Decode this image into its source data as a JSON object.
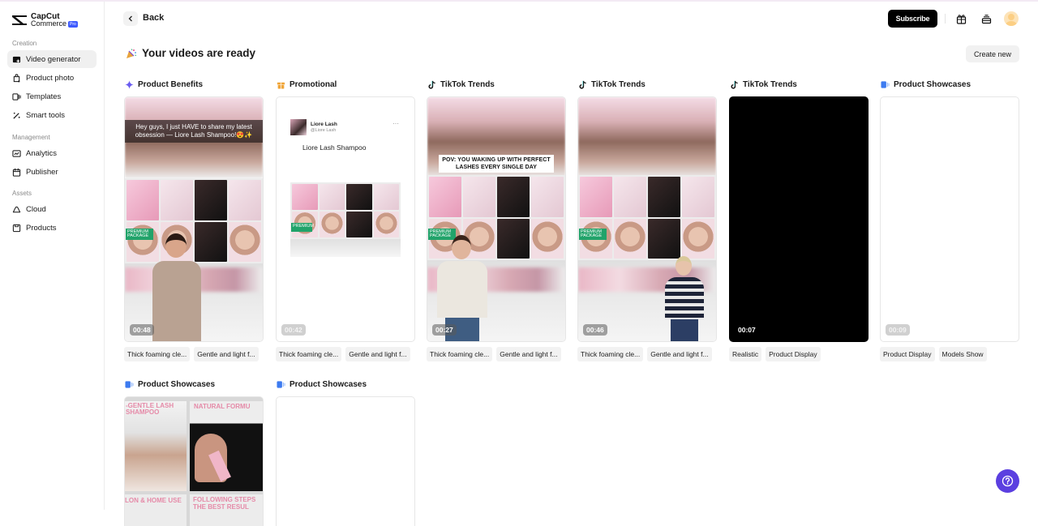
{
  "app": {
    "brand_line1": "CapCut",
    "brand_line2": "Commerce",
    "brand_badge": "Pro"
  },
  "sidebar": {
    "sections": [
      {
        "label": "Creation",
        "items": [
          {
            "label": "Video generator",
            "icon": "video-generator-icon",
            "active": true
          },
          {
            "label": "Product photo",
            "icon": "product-photo-icon",
            "active": false
          },
          {
            "label": "Templates",
            "icon": "templates-icon",
            "active": false
          },
          {
            "label": "Smart tools",
            "icon": "magic-wand-icon",
            "active": false
          }
        ]
      },
      {
        "label": "Management",
        "items": [
          {
            "label": "Analytics",
            "icon": "analytics-icon",
            "active": false
          },
          {
            "label": "Publisher",
            "icon": "calendar-icon",
            "active": false
          }
        ]
      },
      {
        "label": "Assets",
        "items": [
          {
            "label": "Cloud",
            "icon": "cloud-icon",
            "active": false
          },
          {
            "label": "Products",
            "icon": "products-icon",
            "active": false
          }
        ]
      }
    ]
  },
  "header": {
    "back_label": "Back",
    "subscribe_label": "Subscribe",
    "gift_icon": "gift-icon",
    "layers_icon": "stack-icon",
    "avatar_icon": "user-avatar"
  },
  "main": {
    "title": "Your videos are ready",
    "title_icon": "party-popper-icon",
    "create_new_label": "Create new",
    "videos": [
      {
        "category": "Product Benefits",
        "icon": "sparkle-icon",
        "duration": "00:48",
        "caption": "Hey guys, I just HAVE to share my latest obsession — Liore Lash Shampoo!😍✨",
        "tags": [
          "Thick foaming cle...",
          "Gentle and light f..."
        ]
      },
      {
        "category": "Promotional",
        "icon": "gift-box-icon",
        "duration": "00:42",
        "post_account_name": "Liore Lash",
        "post_handle": "@Liore Lash",
        "post_title": "Liore Lash Shampoo",
        "tags": [
          "Thick foaming cle...",
          "Gentle and light f..."
        ]
      },
      {
        "category": "TikTok Trends",
        "icon": "tiktok-icon",
        "duration": "00:27",
        "caption": "POV: YOU WAKING UP WITH PERFECT LASHES EVERY SINGLE DAY",
        "tags": [
          "Thick foaming cle...",
          "Gentle and light f..."
        ]
      },
      {
        "category": "TikTok Trends",
        "icon": "tiktok-icon",
        "duration": "00:46",
        "tags": [
          "Thick foaming cle...",
          "Gentle and light f..."
        ]
      },
      {
        "category": "TikTok Trends",
        "icon": "tiktok-icon",
        "duration": "00:07",
        "tags": [
          "Realistic",
          "Product Display"
        ]
      },
      {
        "category": "Product Showcases",
        "icon": "showcase-icon",
        "duration": "00:09",
        "tags": [
          "Product Display",
          "Models Show"
        ]
      },
      {
        "category": "Product Showcases",
        "icon": "showcase-icon",
        "panel_texts": [
          "-GENTLE LASH SHAMPOO",
          "NATURAL FORMU",
          "LON & HOME USE",
          "FOLLOWING STEPS THE BEST RESUL"
        ]
      },
      {
        "category": "Product Showcases",
        "icon": "showcase-icon"
      }
    ],
    "premium_label_1": "PREMIUM",
    "premium_label_2": "PACKAGE"
  },
  "help": {
    "icon": "help-icon"
  },
  "colors": {
    "accent_purple": "#5b3fe0",
    "subscribe_bg": "#000000",
    "active_nav_bg": "#f0f0f0",
    "premium_green": "#21a36a"
  }
}
